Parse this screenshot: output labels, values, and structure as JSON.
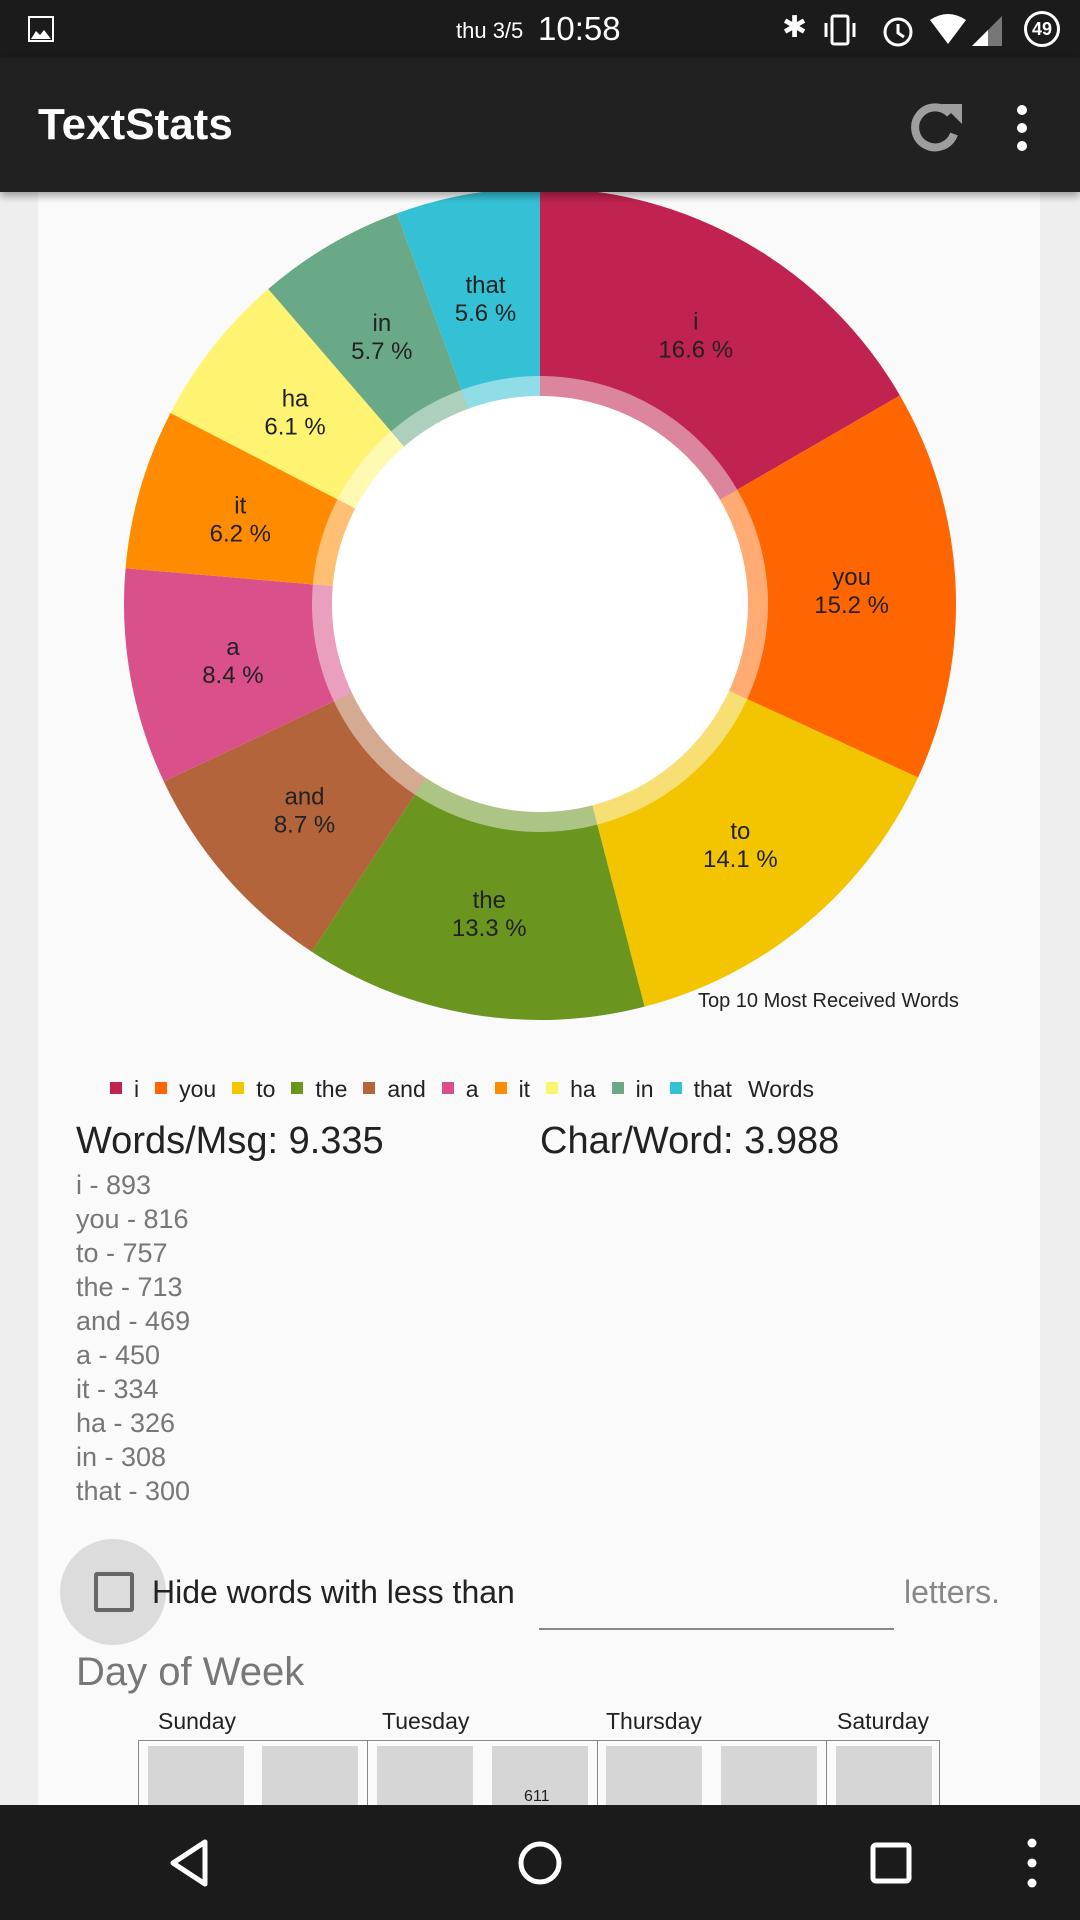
{
  "status_bar": {
    "date": "thu 3/5",
    "time": "10:58",
    "battery": "49",
    "icons": [
      "gallery-icon",
      "bluetooth-icon",
      "vibrate-icon",
      "alarm-icon",
      "wifi-icon",
      "signal-icon",
      "battery-icon"
    ]
  },
  "app_bar": {
    "title": "TextStats",
    "icons": [
      "refresh-icon",
      "overflow-menu-icon"
    ]
  },
  "chart_data": [
    {
      "type": "pie",
      "variant": "donut",
      "description_label": "Top 10 Most Received Words",
      "legend_title": "Words",
      "legend_position": "bottom",
      "categories": [
        "i",
        "you",
        "to",
        "the",
        "and",
        "a",
        "it",
        "ha",
        "in",
        "that"
      ],
      "values": [
        893,
        816,
        757,
        713,
        469,
        450,
        334,
        326,
        308,
        300
      ],
      "percent_labels": [
        "16.6 %",
        "15.2 %",
        "14.1 %",
        "13.3 %",
        "8.7 %",
        "8.4 %",
        "6.2 %",
        "6.1 %",
        "5.7 %",
        "5.6 %"
      ],
      "colors": [
        "#c0234f",
        "#ff6600",
        "#f2c500",
        "#6a961f",
        "#b3643a",
        "#d9508a",
        "#ff8c00",
        "#fff471",
        "#6aa987",
        "#35c1d5"
      ]
    },
    {
      "type": "bar",
      "title": "Day of Week",
      "tick_labels": [
        "Sunday",
        "Tuesday",
        "Thursday",
        "Saturday"
      ],
      "visible_value_label": "611"
    }
  ],
  "stats": {
    "words_per_msg": "Words/Msg: 9.335",
    "char_per_word": "Char/Word: 3.988",
    "word_list": [
      "i - 893",
      "you - 816",
      "to - 757",
      "the - 713",
      "and - 469",
      "a - 450",
      "it - 334",
      "ha - 326",
      "in - 308",
      "that - 300"
    ]
  },
  "filter": {
    "checkbox_label": "Hide words with less than",
    "input_value": "",
    "suffix": "letters.",
    "checked": false
  },
  "nav_bar": {
    "icons": [
      "back-icon",
      "home-icon",
      "recents-icon",
      "menu-icon"
    ]
  }
}
